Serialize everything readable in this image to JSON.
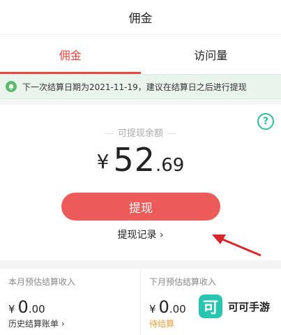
{
  "header": {
    "title": "佣金"
  },
  "tabs": [
    {
      "label": "佣金",
      "active": true
    },
    {
      "label": "访问量",
      "active": false
    }
  ],
  "notice": {
    "icon": "bell-icon",
    "text": "下一次结算日期为2021-11-19，建议在结算日之后进行提现",
    "color": "#e9f4ec"
  },
  "balance": {
    "label": "可提现余额",
    "currency": "¥",
    "integer": "52",
    "decimal": ".69"
  },
  "withdraw_button": {
    "label": "提现",
    "color": "#ec5b59"
  },
  "withdraw_records": {
    "label": "提现记录",
    "arrow": "›"
  },
  "help_icon": {
    "symbol": "?"
  },
  "this_month": {
    "label": "本月预估结算收入",
    "currency": "¥",
    "integer": "0",
    "decimal": ".00",
    "footer": "历史结算账单",
    "arrow": "›"
  },
  "next_month": {
    "label": "下月预估结算收入",
    "currency": "¥",
    "integer": "0",
    "decimal": ".00",
    "footer": "待结算"
  },
  "watermark": {
    "logo_char": "可",
    "text": "可可手游"
  },
  "accent": "#e8463f"
}
